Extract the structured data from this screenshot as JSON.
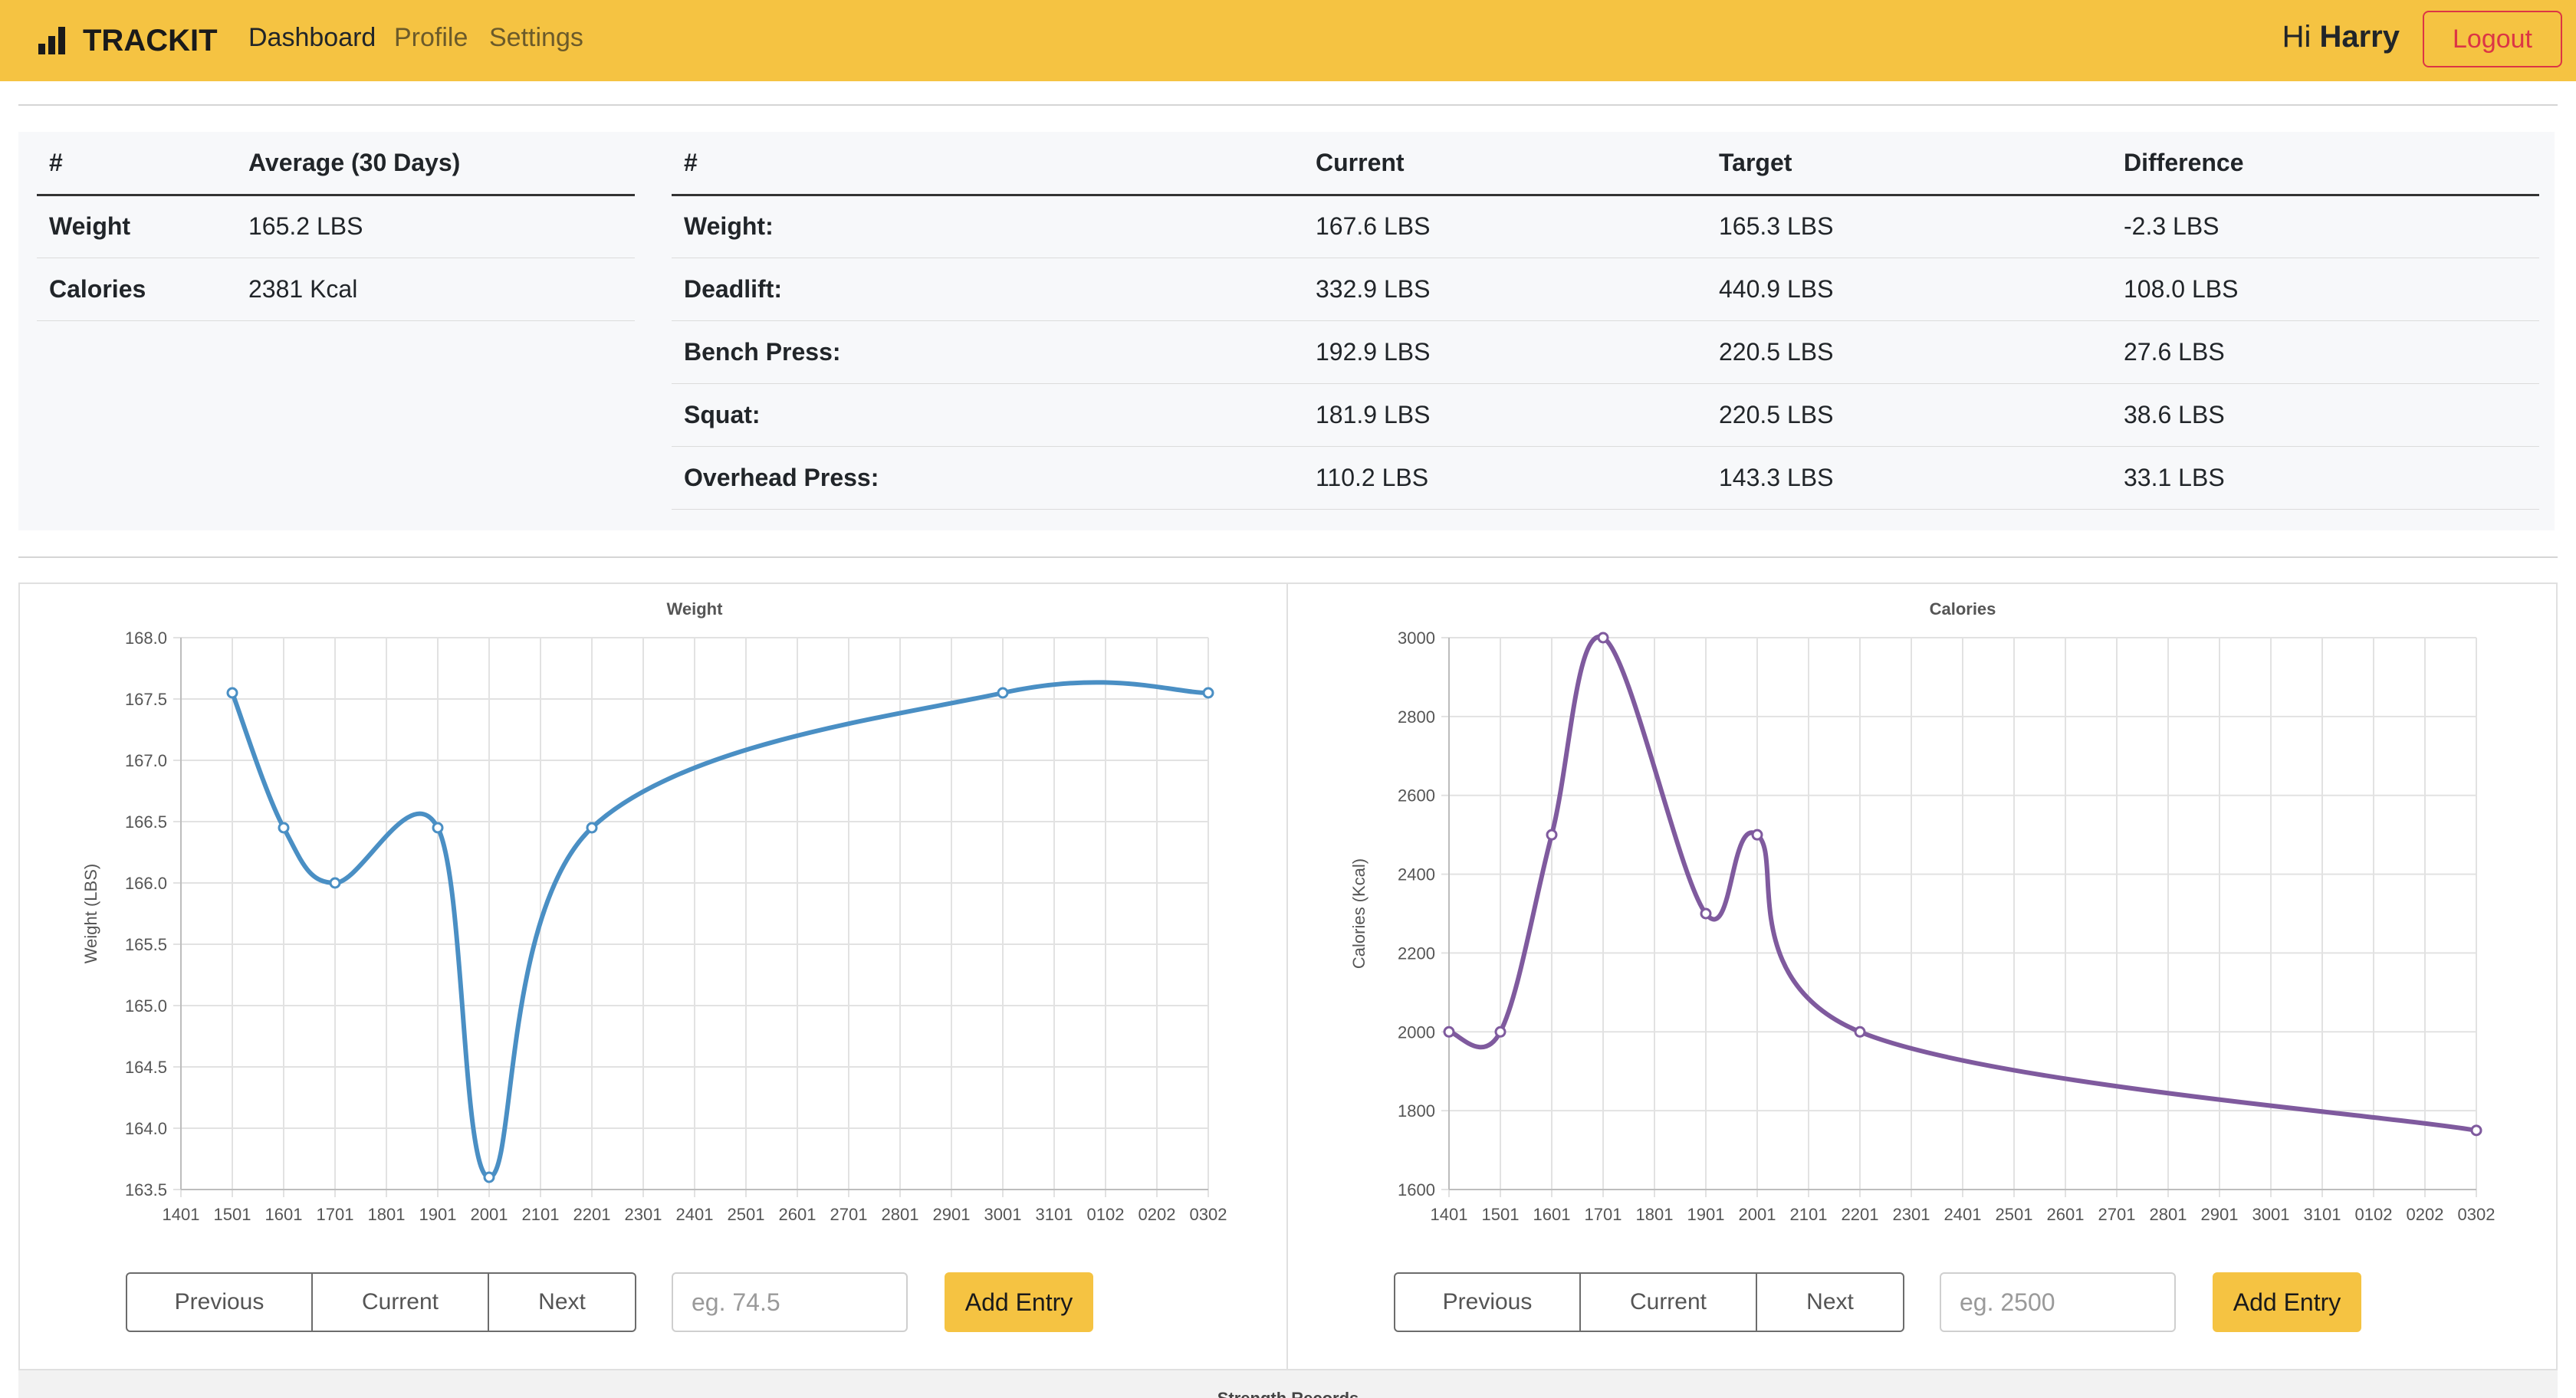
{
  "nav": {
    "brand": "TRACKIT",
    "links": [
      "Dashboard",
      "Profile",
      "Settings"
    ],
    "greeting_prefix": "Hi",
    "user_name": "Harry",
    "logout_label": "Logout",
    "accent_color": "#f5c342"
  },
  "averages": {
    "headers": [
      "#",
      "Average (30 Days)"
    ],
    "rows": [
      [
        "Weight",
        "165.2 LBS"
      ],
      [
        "Calories",
        "2381 Kcal"
      ]
    ]
  },
  "targets": {
    "headers": [
      "#",
      "Current",
      "Target",
      "Difference"
    ],
    "rows": [
      [
        "Weight:",
        "167.6 LBS",
        "165.3 LBS",
        "-2.3 LBS"
      ],
      [
        "Deadlift:",
        "332.9 LBS",
        "440.9 LBS",
        "108.0 LBS"
      ],
      [
        "Bench Press:",
        "192.9 LBS",
        "220.5 LBS",
        "27.6 LBS"
      ],
      [
        "Squat:",
        "181.9 LBS",
        "220.5 LBS",
        "38.6 LBS"
      ],
      [
        "Overhead Press:",
        "110.2 LBS",
        "143.3 LBS",
        "33.1 LBS"
      ]
    ]
  },
  "weight_controls": {
    "previous": "Previous",
    "current": "Current",
    "next": "Next",
    "placeholder": "eg. 74.5",
    "add": "Add Entry"
  },
  "calorie_controls": {
    "previous": "Previous",
    "current": "Current",
    "next": "Next",
    "placeholder": "eg. 2500",
    "add": "Add Entry"
  },
  "strength_title": "Strength Records",
  "chart_data": [
    {
      "type": "line",
      "title": "Weight",
      "xlabel": "",
      "ylabel": "Weight (LBS)",
      "categories": [
        "1401",
        "1501",
        "1601",
        "1701",
        "1801",
        "1901",
        "2001",
        "2101",
        "2201",
        "2301",
        "2401",
        "2501",
        "2601",
        "2701",
        "2801",
        "2901",
        "3001",
        "3101",
        "0102",
        "0202",
        "0302"
      ],
      "ylim": [
        163.5,
        168.0
      ],
      "yticks": [
        163.5,
        164.0,
        164.5,
        165.0,
        165.5,
        166.0,
        166.5,
        167.0,
        167.5,
        168.0
      ],
      "series": [
        {
          "color": "#4a8fc4",
          "points": [
            {
              "x": "1501",
              "y": 167.55
            },
            {
              "x": "1601",
              "y": 166.45
            },
            {
              "x": "1701",
              "y": 166.0
            },
            {
              "x": "1901",
              "y": 166.45
            },
            {
              "x": "2001",
              "y": 163.6
            },
            {
              "x": "2201",
              "y": 166.45
            },
            {
              "x": "3001",
              "y": 167.55
            },
            {
              "x": "0302",
              "y": 167.55
            }
          ]
        }
      ],
      "grid": true
    },
    {
      "type": "line",
      "title": "Calories",
      "xlabel": "",
      "ylabel": "Calories (Kcal)",
      "categories": [
        "1401",
        "1501",
        "1601",
        "1701",
        "1801",
        "1901",
        "2001",
        "2101",
        "2201",
        "2301",
        "2401",
        "2501",
        "2601",
        "2701",
        "2801",
        "2901",
        "3001",
        "3101",
        "0102",
        "0202",
        "0302"
      ],
      "ylim": [
        1600,
        3000
      ],
      "yticks": [
        1600,
        1800,
        2000,
        2200,
        2400,
        2600,
        2800,
        3000
      ],
      "series": [
        {
          "color": "#7f5a9e",
          "points": [
            {
              "x": "1401",
              "y": 2000
            },
            {
              "x": "1501",
              "y": 2000
            },
            {
              "x": "1601",
              "y": 2500
            },
            {
              "x": "1701",
              "y": 3000
            },
            {
              "x": "1901",
              "y": 2300
            },
            {
              "x": "2001",
              "y": 2500
            },
            {
              "x": "2201",
              "y": 2000
            },
            {
              "x": "0302",
              "y": 1750
            }
          ]
        }
      ],
      "grid": true
    }
  ]
}
